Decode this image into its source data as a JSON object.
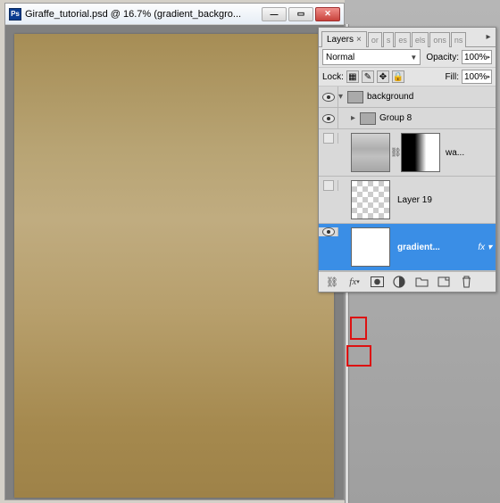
{
  "app_name": "Ps",
  "document": {
    "title": "Giraffe_tutorial.psd @ 16.7% (gradient_backgro..."
  },
  "window_buttons": {
    "minimize": "—",
    "maximize": "▭",
    "close": "✕"
  },
  "panel": {
    "tabs": {
      "layers": "Layers",
      "t2": "or",
      "t3": "s",
      "t4": "es",
      "t5": "els",
      "t6": "ons",
      "t7": "ns"
    },
    "blend_mode": "Normal",
    "opacity_label": "Opacity:",
    "opacity_value": "100%",
    "lock_label": "Lock:",
    "fill_label": "Fill:",
    "fill_value": "100%",
    "layers": {
      "background_group": "background",
      "group8": "Group 8",
      "wa": "wa...",
      "layer19": "Layer 19",
      "gradient": "gradient...",
      "fx": "fx"
    }
  }
}
